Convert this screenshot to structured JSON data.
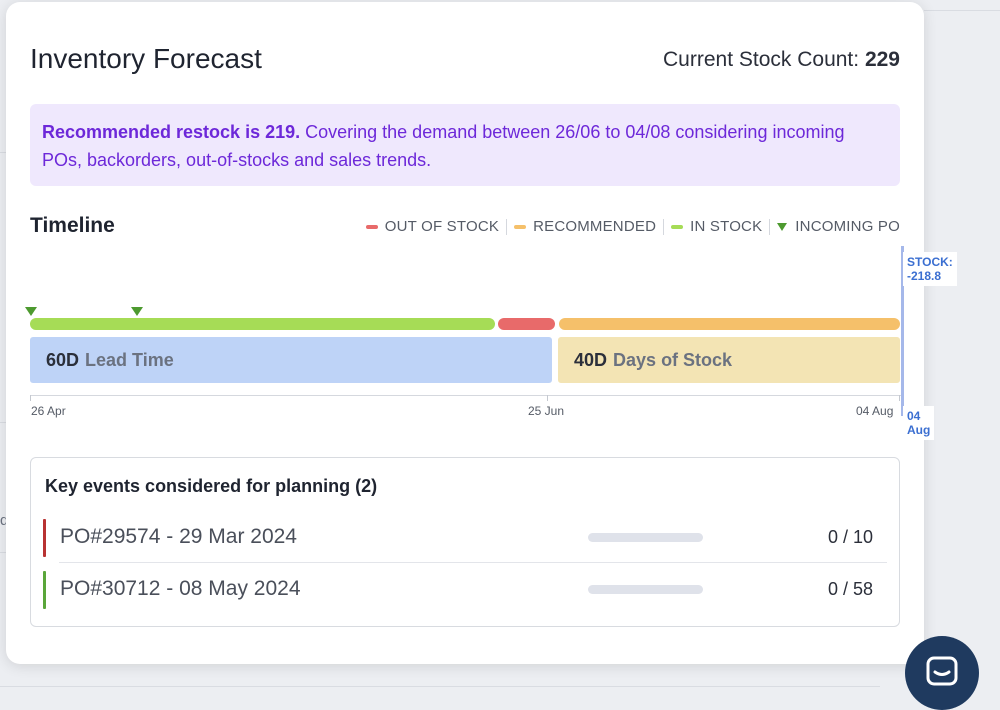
{
  "background": {
    "partial_text": "d"
  },
  "header": {
    "title": "Inventory Forecast",
    "stock_count_label": "Current Stock Count:",
    "stock_count_value": "229"
  },
  "banner": {
    "strong": "Recommended restock is 219.",
    "text": " Covering the demand between 26/06 to 04/08 considering incoming POs, backorders, out-of-stocks and sales trends."
  },
  "timeline": {
    "title": "Timeline",
    "legend": [
      {
        "label": "OUT OF STOCK",
        "color": "#e86a6a",
        "marker": "dash"
      },
      {
        "label": "RECOMMENDED",
        "color": "#f5c06a",
        "marker": "dash"
      },
      {
        "label": "IN STOCK",
        "color": "#a6dc56",
        "marker": "dash"
      },
      {
        "label": "INCOMING PO",
        "color": "#4d9a2f",
        "marker": "triangle"
      }
    ],
    "lead_time": {
      "value": "60D",
      "label": "Lead Time",
      "color": "#bed3f7"
    },
    "days_of_stock": {
      "value": "40D",
      "label": "Days of Stock",
      "color": "#f3e4b4"
    },
    "axis_dates": [
      "26 Apr",
      "25 Jun",
      "04 Aug"
    ],
    "stock_tag": "STOCK: -218.8",
    "date_tag": "04 Aug"
  },
  "events": {
    "title": "Key events considered for planning (2)",
    "items": [
      {
        "name": "PO#29574 - 29 Mar 2024",
        "quantity": "0 / 10",
        "received": 0,
        "ordered": 10,
        "status_color": "#b83232"
      },
      {
        "name": "PO#30712 - 08 May 2024",
        "quantity": "0 / 58",
        "received": 0,
        "ordered": 58,
        "status_color": "#5aa63a"
      }
    ]
  },
  "colors": {
    "accent": "#6d28d9",
    "banner_bg": "#efe8fd",
    "out_of_stock": "#e86a6a",
    "recommended": "#f5c06a",
    "in_stock": "#a6dc56",
    "incoming_po": "#4d9a2f",
    "stock_marker": "#3b6fd1"
  },
  "icons": {
    "chat": "chat-bubble-icon",
    "incoming_po": "triangle-down-icon"
  }
}
